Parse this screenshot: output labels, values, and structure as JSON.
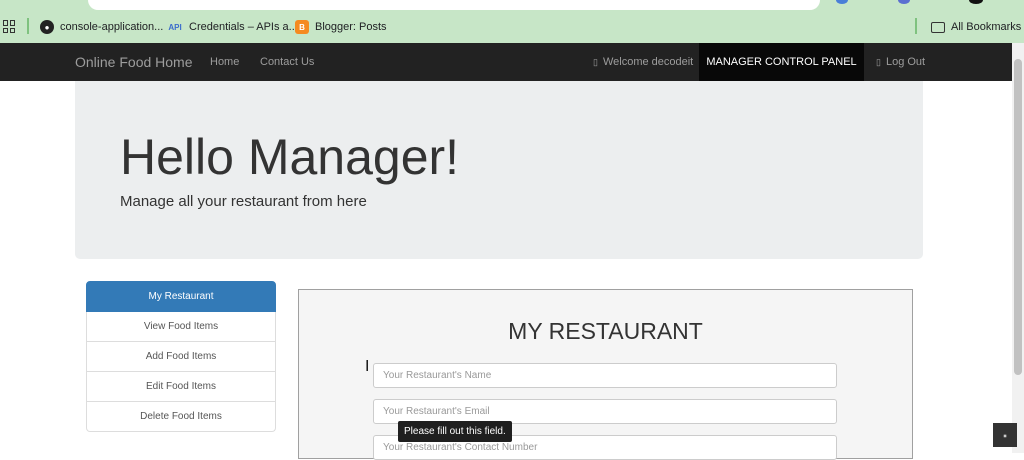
{
  "browser": {
    "bookmarks": [
      {
        "label": "console-application...",
        "icon": "github-icon"
      },
      {
        "label": "Credentials – APIs a...",
        "icon": "api-icon"
      },
      {
        "label": "Blogger: Posts",
        "icon": "blogger-icon"
      }
    ],
    "all_bookmarks_label": "All Bookmarks",
    "api_icon_text": "API",
    "blogger_icon_text": "B"
  },
  "navbar": {
    "brand": "Online Food Home",
    "links": [
      "Home",
      "Contact Us"
    ],
    "welcome": "Welcome decodeit",
    "control_panel": "MANAGER CONTROL PANEL",
    "logout": "Log Out",
    "user_icon": "user-icon",
    "logout_icon": "logout-icon"
  },
  "jumbotron": {
    "title": "Hello Manager!",
    "subtitle": "Manage all your restaurant from here"
  },
  "sidebar": {
    "items": [
      {
        "label": "My Restaurant",
        "active": true
      },
      {
        "label": "View Food Items"
      },
      {
        "label": "Add Food Items"
      },
      {
        "label": "Edit Food Items"
      },
      {
        "label": "Delete Food Items"
      }
    ]
  },
  "form": {
    "title": "MY RESTAURANT",
    "name_placeholder": "Your Restaurant's Name",
    "email_placeholder": "Your Restaurant's Email",
    "contact_placeholder": "Your Restaurant's Contact Number"
  },
  "tooltip": "Please fill out this field.",
  "colors": {
    "navbar": "#222222",
    "active_item": "#337ab7",
    "browser_bar": "#c7e6c7"
  }
}
